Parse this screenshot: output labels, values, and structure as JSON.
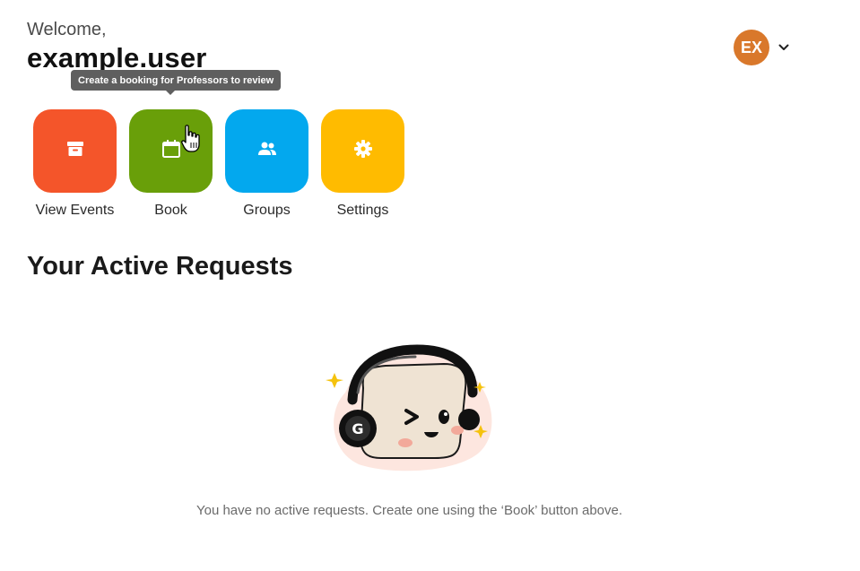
{
  "header": {
    "welcome": "Welcome,",
    "username": "example.user"
  },
  "user_menu": {
    "initials": "EX",
    "avatar_color": "#d9782b",
    "chevron_icon": "chevron-down-icon"
  },
  "tooltip": {
    "text": "Create a booking for Professors to review"
  },
  "tiles": [
    {
      "label": "View Events",
      "color": "#f4552a",
      "icon": "archive-icon"
    },
    {
      "label": "Book",
      "color": "#699f09",
      "icon": "calendar-icon"
    },
    {
      "label": "Groups",
      "color": "#03a8ee",
      "icon": "people-icon"
    },
    {
      "label": "Settings",
      "color": "#ffbb00",
      "icon": "gear-icon"
    }
  ],
  "requests": {
    "title": "Your Active Requests",
    "empty_message": "You have no active requests. Create one using the ‘Book’ button above.",
    "mascot_letter": "G"
  }
}
